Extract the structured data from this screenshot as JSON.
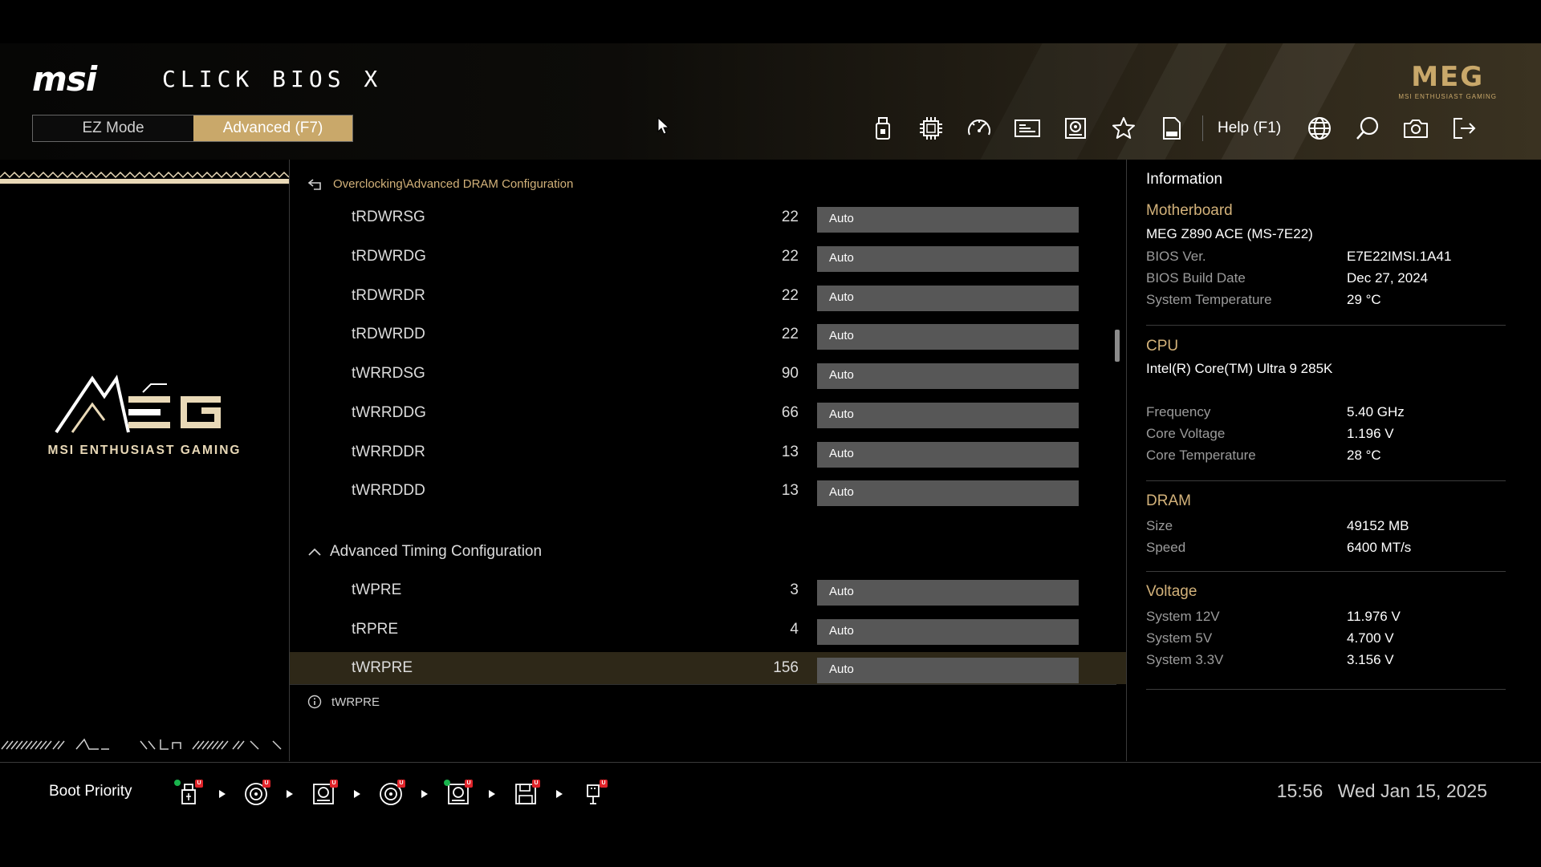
{
  "header": {
    "brand": "msi",
    "product": "CLICK BIOS X",
    "modes": {
      "ez": "EZ Mode",
      "advanced": "Advanced (F7)"
    },
    "help_label": "Help (F1)",
    "meg_logo": "MEG",
    "meg_tagline": "MSI ENTHUSIAST GAMING",
    "toolbar_icons": [
      "usb-flash-icon",
      "cpu-icon",
      "speedometer-icon",
      "monitor-panel-icon",
      "hardware-monitor-icon",
      "favorite-star-icon",
      "log-file-icon"
    ],
    "right_icons": [
      "globe-icon",
      "search-icon",
      "screenshot-camera-icon",
      "exit-icon"
    ]
  },
  "left_panel": {
    "logo": "MEG",
    "tagline": "MSI ENTHUSIAST GAMING"
  },
  "center": {
    "breadcrumb": "Overclocking\\Advanced DRAM Configuration",
    "rows": [
      {
        "name": "tRDWRSG",
        "value": "22",
        "setting": "Auto"
      },
      {
        "name": "tRDWRDG",
        "value": "22",
        "setting": "Auto"
      },
      {
        "name": "tRDWRDR",
        "value": "22",
        "setting": "Auto"
      },
      {
        "name": "tRDWRDD",
        "value": "22",
        "setting": "Auto"
      },
      {
        "name": "tWRRDSG",
        "value": "90",
        "setting": "Auto"
      },
      {
        "name": "tWRRDDG",
        "value": "66",
        "setting": "Auto"
      },
      {
        "name": "tWRRDDR",
        "value": "13",
        "setting": "Auto"
      },
      {
        "name": "tWRRDDD",
        "value": "13",
        "setting": "Auto"
      }
    ],
    "section_title": "Advanced Timing Configuration",
    "section_rows": [
      {
        "name": "tWPRE",
        "value": "3",
        "setting": "Auto"
      },
      {
        "name": "tRPRE",
        "value": "4",
        "setting": "Auto"
      },
      {
        "name": "tWRPRE",
        "value": "156",
        "setting": "Auto"
      }
    ],
    "help_text": "tWRPRE"
  },
  "info": {
    "title": "Information",
    "motherboard": {
      "title": "Motherboard",
      "model": "MEG Z890 ACE (MS-7E22)",
      "bios_ver_label": "BIOS Ver.",
      "bios_ver": "E7E22IMSI.1A41",
      "build_date_label": "BIOS Build Date",
      "build_date": "Dec 27, 2024",
      "sys_temp_label": "System Temperature",
      "sys_temp": "29 °C"
    },
    "cpu": {
      "title": "CPU",
      "model": "Intel(R) Core(TM) Ultra 9 285K",
      "freq_label": "Frequency",
      "freq": "5.40 GHz",
      "volt_label": "Core Voltage",
      "volt": "1.196 V",
      "temp_label": "Core Temperature",
      "temp": "28 °C"
    },
    "dram": {
      "title": "DRAM",
      "size_label": "Size",
      "size": "49152 MB",
      "speed_label": "Speed",
      "speed": "6400 MT/s"
    },
    "voltage": {
      "title": "Voltage",
      "v12_label": "System 12V",
      "v12": "11.976 V",
      "v5_label": "System 5V",
      "v5": "4.700 V",
      "v33_label": "System 3.3V",
      "v33": "3.156 V"
    }
  },
  "footer": {
    "boot_priority": "Boot Priority",
    "boot_devices": [
      "usb-key-icon",
      "optical-disc-icon",
      "hard-disk-icon",
      "optical-disc-icon",
      "network-disk-icon",
      "floppy-disk-icon",
      "usb-device-icon"
    ],
    "time": "15:56",
    "date": "Wed Jan 15, 2025"
  },
  "colors": {
    "accent": "#c9a86a",
    "gold_text": "#d3b27a",
    "field": "#575757",
    "selected_row": "#2e2818"
  }
}
